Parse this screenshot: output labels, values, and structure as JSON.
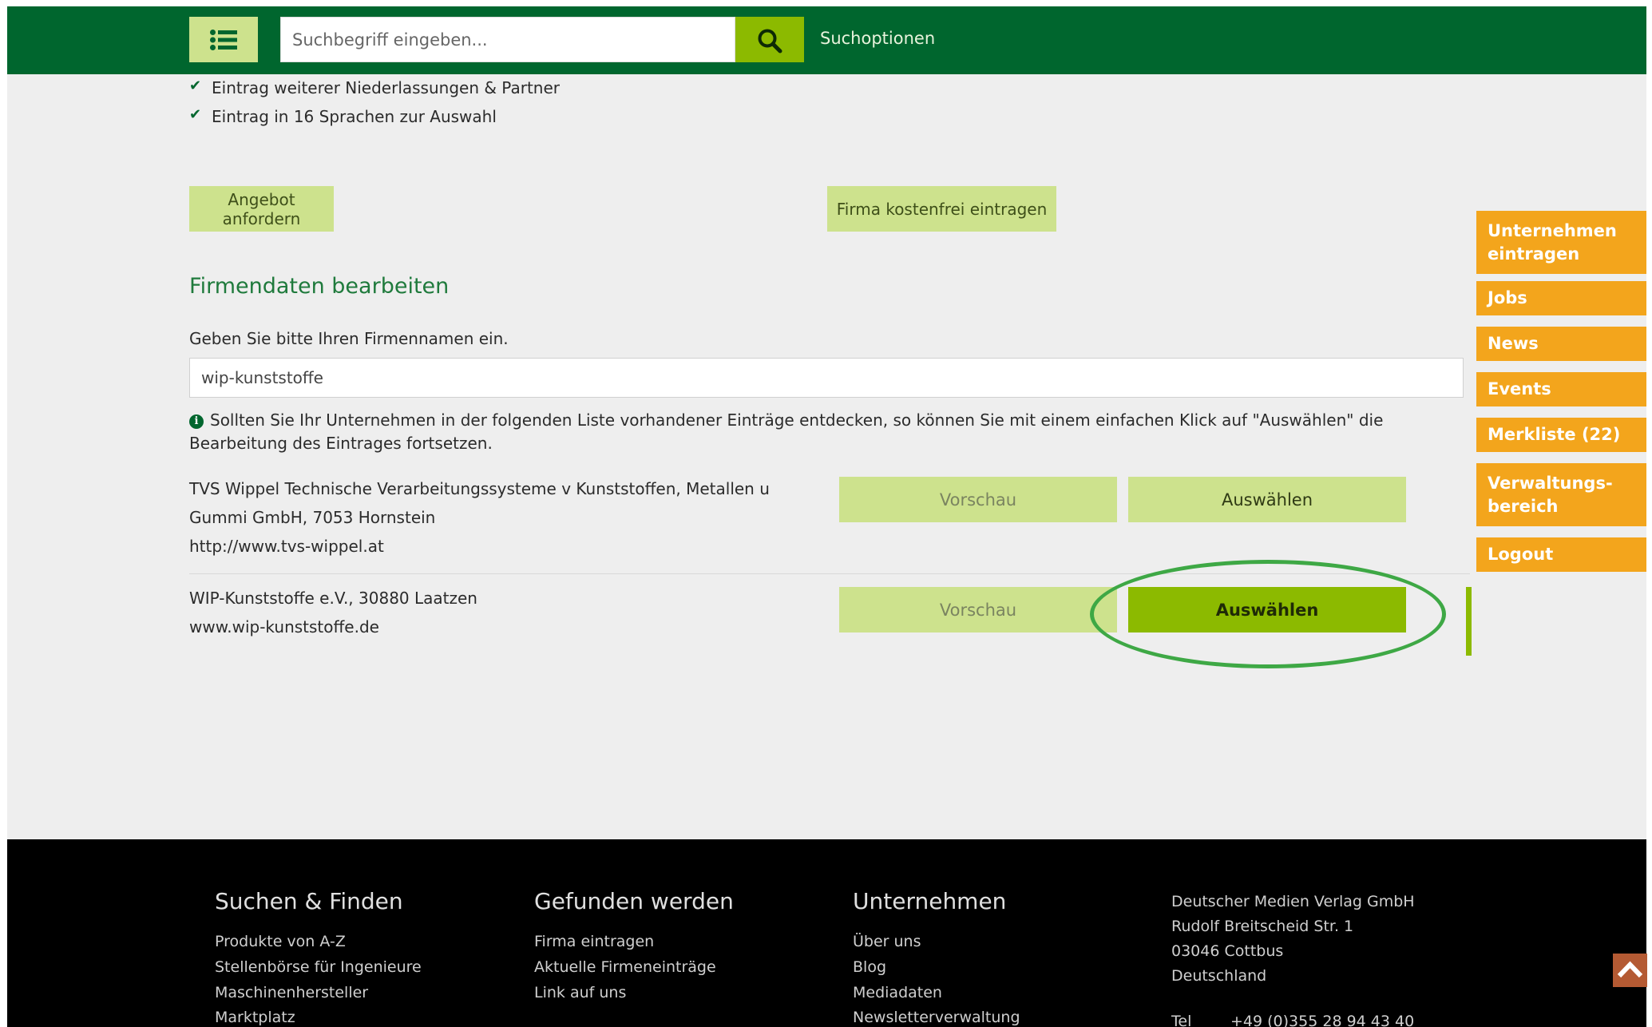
{
  "header": {
    "search_placeholder": "Suchbegriff eingeben...",
    "search_options_label": "Suchoptionen"
  },
  "features": [
    "Eintrag weiterer Niederlassungen & Partner",
    "Eintrag in 16 Sprachen zur Auswahl"
  ],
  "actions": {
    "request_offer": "Angebot anfordern",
    "register_free": "Firma kostenfrei eintragen"
  },
  "edit": {
    "title": "Firmendaten bearbeiten",
    "name_label": "Geben Sie bitte Ihren Firmennamen ein.",
    "name_value": "wip-kunststoffe",
    "info_text": "Sollten Sie Ihr Unternehmen in der folgenden Liste vorhandener Einträge entdecken, so können Sie mit einem einfachen Klick auf \"Auswählen\" die Bearbeitung des Eintrages fortsetzen."
  },
  "results": [
    {
      "line1": "TVS Wippel Technische Verarbeitungssysteme v Kunststoffen, Metallen u",
      "line2": "Gummi GmbH, 7053 Hornstein",
      "line3": "http://www.tvs-wippel.at",
      "preview_label": "Vorschau",
      "select_label": "Auswählen"
    },
    {
      "line1": "WIP-Kunststoffe e.V., 30880 Laatzen",
      "line2": "www.wip-kunststoffe.de",
      "preview_label": "Vorschau",
      "select_label": "Auswählen"
    }
  ],
  "side_nav": [
    {
      "label": "Unternehmen eintragen"
    },
    {
      "label": "Jobs"
    },
    {
      "label": "News"
    },
    {
      "label": "Events"
    },
    {
      "label": "Merkliste (22)"
    },
    {
      "label": "Verwaltungs- bereich"
    },
    {
      "label": "Logout"
    }
  ],
  "footer": {
    "col1": {
      "title": "Suchen & Finden",
      "links": [
        "Produkte von A-Z",
        "Stellenbörse für Ingenieure",
        "Maschinenhersteller",
        "Marktplatz"
      ]
    },
    "col2": {
      "title": "Gefunden werden",
      "links": [
        "Firma eintragen",
        "Aktuelle Firmeneinträge",
        "Link auf uns"
      ]
    },
    "col3": {
      "title": "Unternehmen",
      "links": [
        "Über uns",
        "Blog",
        "Mediadaten",
        "Newsletterverwaltung"
      ]
    },
    "address": {
      "company": "Deutscher Medien Verlag GmbH",
      "street": "Rudolf Breitscheid Str. 1",
      "city": "03046 Cottbus",
      "country": "Deutschland",
      "tel_label": "Tel",
      "tel_value": "+49 (0)355 28 94 43 40"
    }
  },
  "colors": {
    "brand_green": "#00662e",
    "accent_green": "#8cba00",
    "light_green": "#cde28d",
    "side_orange": "#f3a51c"
  }
}
